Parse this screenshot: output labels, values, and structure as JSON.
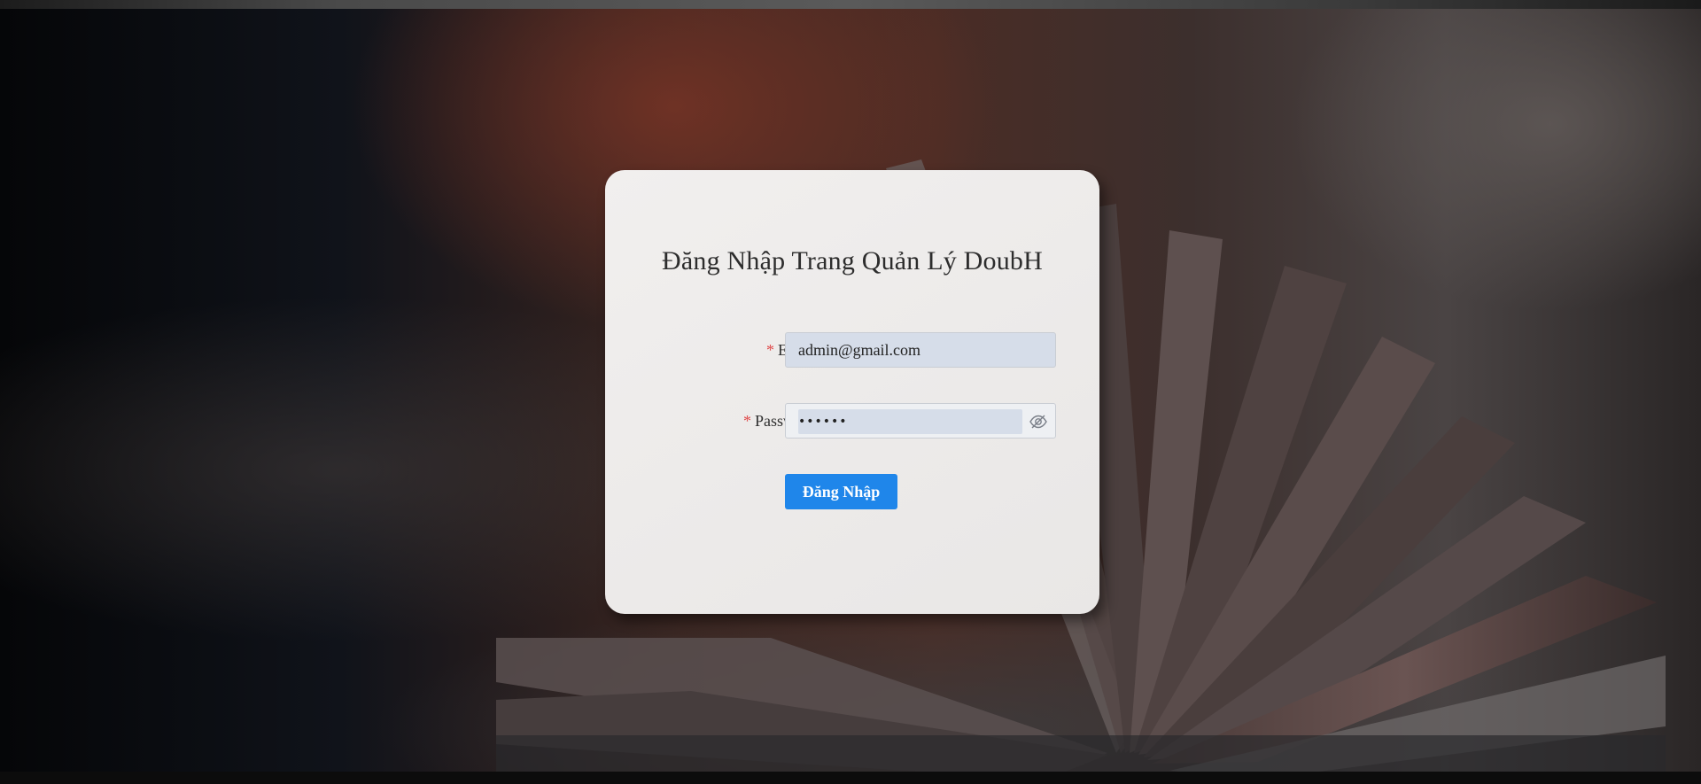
{
  "page": {
    "title": "Đăng Nhập Trang Quản Lý DoubH"
  },
  "form": {
    "email": {
      "label": "Email",
      "required_mark": "*",
      "value": "admin@gmail.com"
    },
    "password": {
      "label": "Password",
      "required_mark": "*",
      "value": "123456",
      "masked": true,
      "toggle_icon": "eye-slash-icon"
    },
    "submit_label": "Đăng Nhập"
  },
  "colors": {
    "primary": "#1f86ea",
    "required": "#e04a4a",
    "input_autofill": "#d6dde9",
    "card": "#efedec"
  },
  "background": {
    "image_subject": "open-book-photo"
  }
}
